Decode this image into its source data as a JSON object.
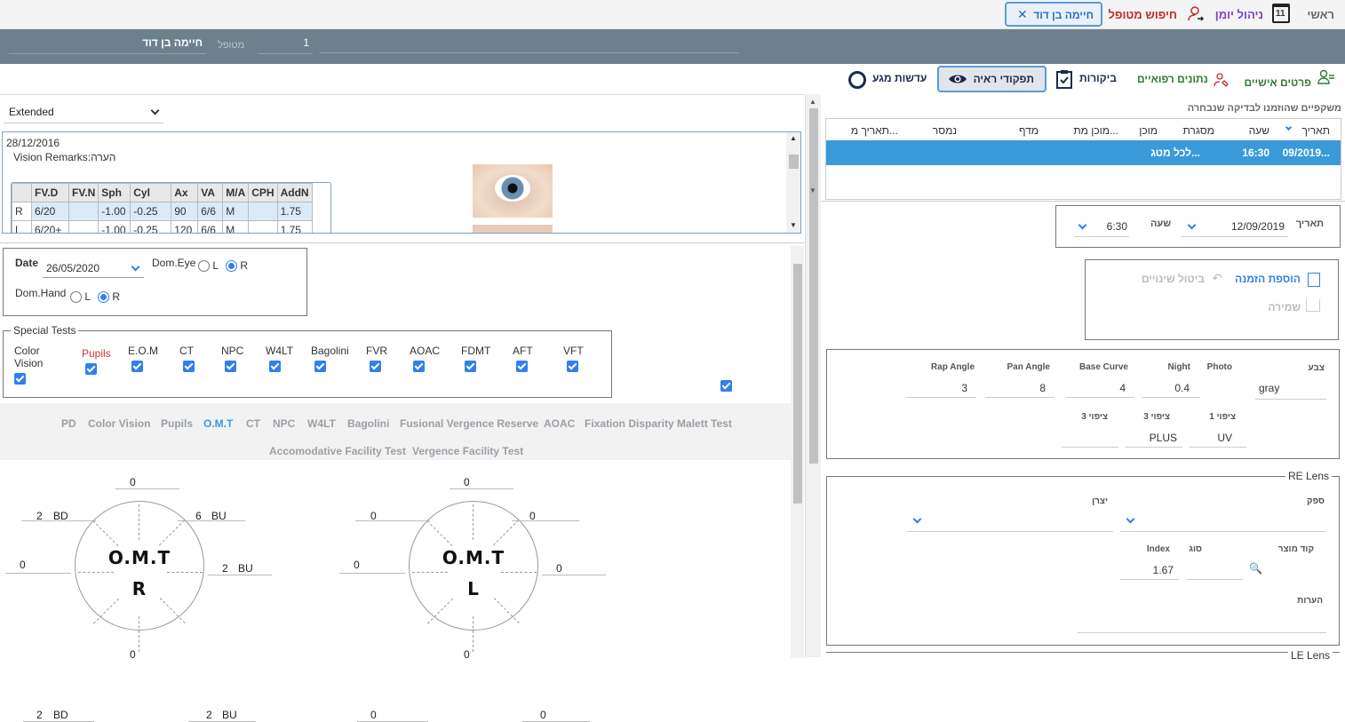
{
  "nav": {
    "home": "ראשי",
    "calendar_label": "ניהול יומן",
    "calendar_day": "11",
    "search_patient": "חיפוש מטופל",
    "patient_tab": "חיימה בן דוד"
  },
  "patient_bar": {
    "patient_label": "מטופל",
    "patient_name": "חיימה בן דוד",
    "patient_number": "1"
  },
  "sections": {
    "personal": "פרטים אישיים",
    "medical": "נתונים רפואיים",
    "visits": "ביקורות",
    "vision": "תפקודי ראיה",
    "contact_lenses": "עדשות מגע"
  },
  "left": {
    "view_mode": "Extended",
    "history": {
      "date": "28/12/2016",
      "remark_label": "Vision Remarks:",
      "remark_heb": "הערה",
      "headers": [
        "",
        "FV.D",
        "FV.N",
        "Sph",
        "Cyl",
        "Ax",
        "VA",
        "M/A",
        "CPH",
        "AddN"
      ],
      "rows": [
        [
          "R",
          "6/20",
          "",
          "-1.00",
          "-0.25",
          "90",
          "6/6",
          "M",
          "",
          "1.75"
        ],
        [
          "L",
          "6/20+",
          "",
          "-1.00",
          "-0.25",
          "120",
          "6/6",
          "M",
          "",
          "1.75"
        ]
      ]
    },
    "date_label": "Date",
    "date_value": "26/05/2020",
    "dom_eye": "Dom.Eye",
    "dom_hand": "Dom.Hand",
    "opt_l": "L",
    "opt_r": "R",
    "special_tests_title": "Special Tests",
    "special_tests": [
      {
        "label": "Color Vision"
      },
      {
        "label": "Pupils"
      },
      {
        "label": "E.O.M"
      },
      {
        "label": "CT"
      },
      {
        "label": "NPC"
      },
      {
        "label": "W4LT"
      },
      {
        "label": "Bagolini"
      },
      {
        "label": "FVR"
      },
      {
        "label": "AOAC"
      },
      {
        "label": "FDMT"
      },
      {
        "label": "AFT"
      },
      {
        "label": "VFT"
      }
    ],
    "test_tabs_row1": [
      "PD",
      "Color Vision",
      "Pupils",
      "O.M.T",
      "CT",
      "NPC",
      "W4LT",
      "Bagolini",
      "Fusional Vergence Reserve",
      "AOAC",
      "Fixation Disparity Malett Test"
    ],
    "test_tabs_row2": [
      "Accomodative Facility Test",
      "Vergence Facility Test"
    ],
    "omt_r": {
      "title": "O.M.T",
      "eye": "R",
      "top": "0",
      "bottom": "0",
      "left": "0",
      "tl_val": "2",
      "tl_dir": "BD",
      "tr_val": "6",
      "tr_dir": "BU",
      "right_val": "2",
      "right_dir": "BU",
      "bl_val": "2",
      "bl_dir": "BD",
      "br_val": "2",
      "br_dir": "BU"
    },
    "omt_l": {
      "title": "O.M.T",
      "eye": "L",
      "top": "0",
      "bottom": "0",
      "left": "0",
      "tl": "0",
      "tr": "0",
      "right": "0",
      "bl": "0",
      "br": "0"
    }
  },
  "right": {
    "glasses_title": "משקפיים שהוזמנו לבדיקה שנבחרה",
    "glasses_headers": [
      "תאריך",
      "שעה",
      "מסגרת",
      "מוכן",
      "מוכן מת...",
      "מדף",
      "נמסר",
      "תאריך מ..."
    ],
    "glasses_row": {
      "date": "09/2019...",
      "time": "16:30",
      "frame": "לכל מטג..."
    },
    "date_label": "תאריך",
    "date_value": "12/09/2019",
    "time_label": "שעה",
    "time_value": "6:30",
    "add_order": "הוספת הזמנה",
    "cancel_changes": "ביטול שינויים",
    "save": "שמירה",
    "lens": {
      "color_label": "צבע",
      "color_value": "gray",
      "photo_label": "Photo",
      "night_label": "Night",
      "night_value": "0.4",
      "base_curve_label": "Base Curve",
      "base_curve_value": "4",
      "pan_label": "Pan Angle",
      "pan_value": "8",
      "rap_label": "Rap Angle",
      "rap_value": "3",
      "coat1_label": "ציפוי 1",
      "coat1_value": "UV",
      "coat3_label": "ציפוי 3",
      "coat3_value": "PLUS",
      "coat3b_label": "ציפוי 3",
      "coat3b_value": ""
    },
    "re_lens": {
      "title": "RE Lens",
      "supplier_label": "ספק",
      "maker_label": "יצרן",
      "code_label": "קוד מוצר",
      "type_label": "סוג",
      "index_label": "Index",
      "index_value": "1.67",
      "notes_label": "הערות"
    },
    "le_lens_title": "LE Lens"
  }
}
